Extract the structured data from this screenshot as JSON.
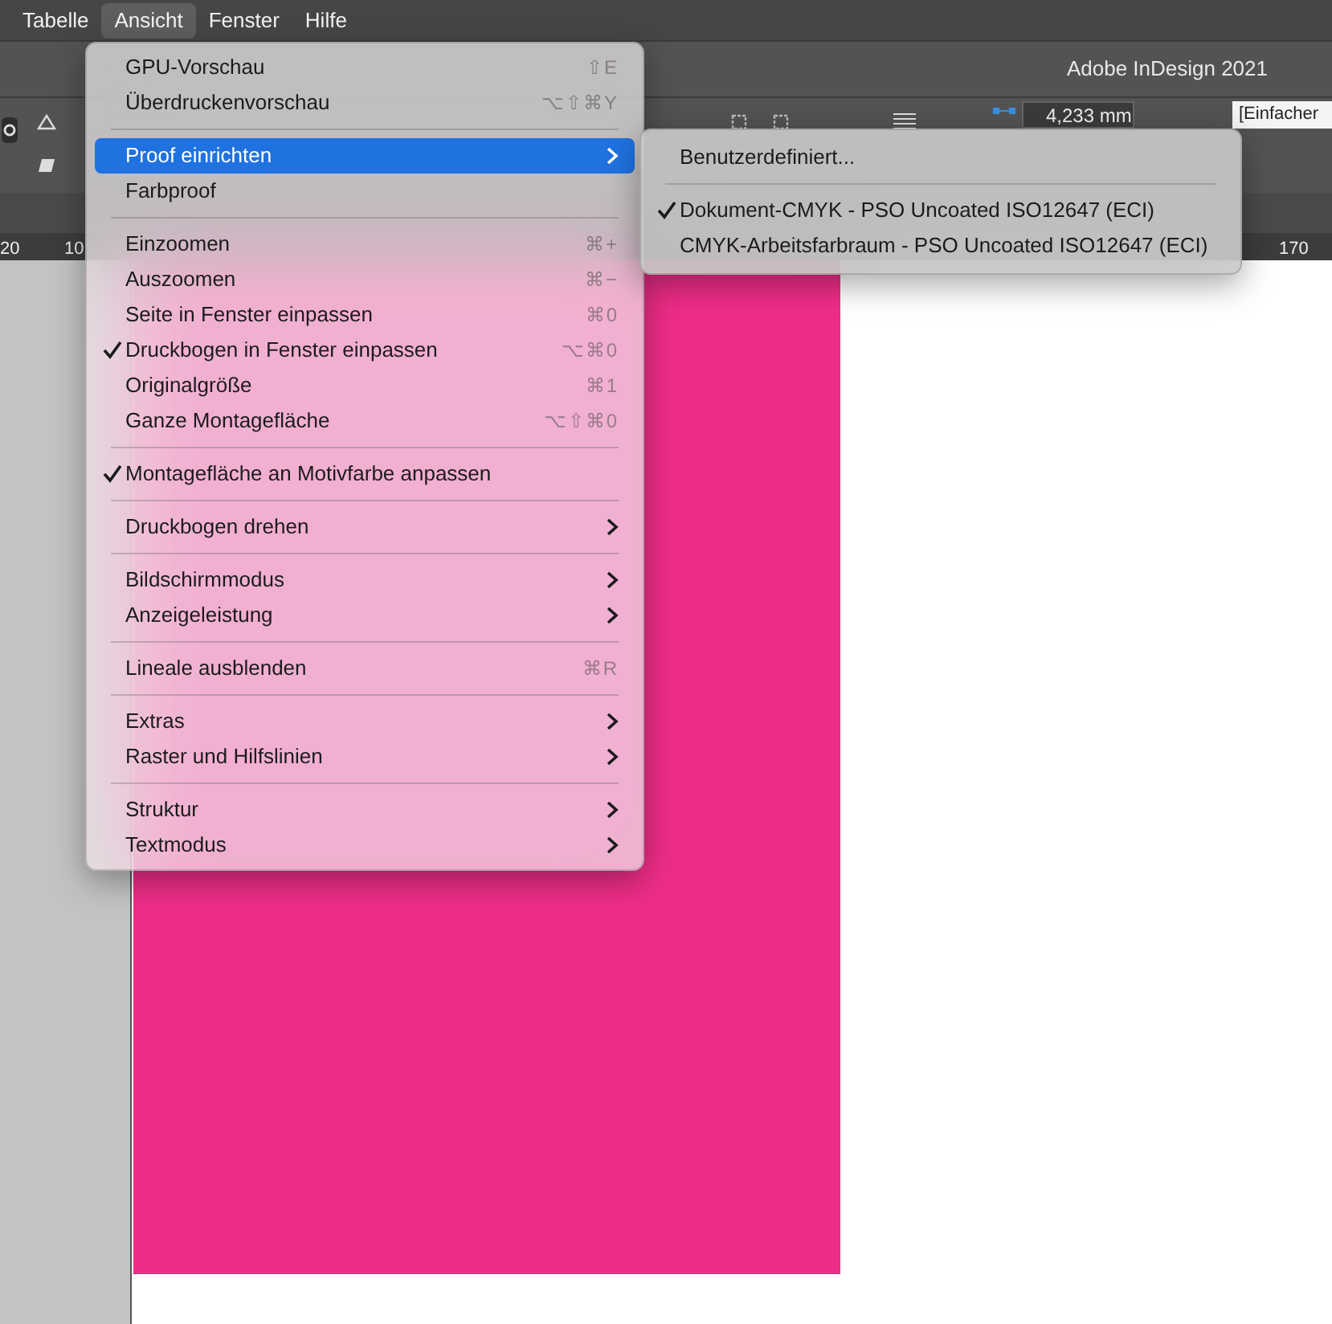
{
  "menubar": [
    {
      "label": "Tabelle",
      "selected": false
    },
    {
      "label": "Ansicht",
      "selected": true
    },
    {
      "label": "Fenster",
      "selected": false
    },
    {
      "label": "Hilfe",
      "selected": false
    }
  ],
  "window": {
    "title": "Adobe InDesign 2021"
  },
  "control_panel": {
    "stroke_weight": "4,233 mm",
    "object_style": "[Einfacher"
  },
  "ruler": {
    "labels": [
      "20",
      "10",
      "170"
    ]
  },
  "menu": [
    {
      "kind": "item",
      "label": "GPU-Vorschau",
      "shortcut": "⇧E",
      "checked": false,
      "submenu": false,
      "selected": false
    },
    {
      "kind": "item",
      "label": "Überdruckenvorschau",
      "shortcut": "⌥⇧⌘Y",
      "checked": false,
      "submenu": false,
      "selected": false
    },
    {
      "kind": "separator"
    },
    {
      "kind": "item",
      "label": "Proof einrichten",
      "checked": false,
      "submenu": true,
      "selected": true
    },
    {
      "kind": "item",
      "label": "Farbproof",
      "checked": false,
      "submenu": false,
      "selected": false
    },
    {
      "kind": "separator"
    },
    {
      "kind": "item",
      "label": "Einzoomen",
      "shortcut": "⌘+",
      "checked": false,
      "submenu": false,
      "selected": false
    },
    {
      "kind": "item",
      "label": "Auszoomen",
      "shortcut": "⌘−",
      "checked": false,
      "submenu": false,
      "selected": false
    },
    {
      "kind": "item",
      "label": "Seite in Fenster einpassen",
      "shortcut": "⌘0",
      "checked": false,
      "submenu": false,
      "selected": false
    },
    {
      "kind": "item",
      "label": "Druckbogen in Fenster einpassen",
      "shortcut": "⌥⌘0",
      "checked": true,
      "submenu": false,
      "selected": false
    },
    {
      "kind": "item",
      "label": "Originalgröße",
      "shortcut": "⌘1",
      "checked": false,
      "submenu": false,
      "selected": false
    },
    {
      "kind": "item",
      "label": "Ganze Montagefläche",
      "shortcut": "⌥⇧⌘0",
      "checked": false,
      "submenu": false,
      "selected": false
    },
    {
      "kind": "separator"
    },
    {
      "kind": "item",
      "label": "Montagefläche an Motivfarbe anpassen",
      "checked": true,
      "submenu": false,
      "selected": false
    },
    {
      "kind": "separator"
    },
    {
      "kind": "item",
      "label": "Druckbogen drehen",
      "checked": false,
      "submenu": true,
      "selected": false
    },
    {
      "kind": "separator"
    },
    {
      "kind": "item",
      "label": "Bildschirmmodus",
      "checked": false,
      "submenu": true,
      "selected": false
    },
    {
      "kind": "item",
      "label": "Anzeigeleistung",
      "checked": false,
      "submenu": true,
      "selected": false
    },
    {
      "kind": "separator"
    },
    {
      "kind": "item",
      "label": "Lineale ausblenden",
      "shortcut": "⌘R",
      "checked": false,
      "submenu": false,
      "selected": false
    },
    {
      "kind": "separator"
    },
    {
      "kind": "item",
      "label": "Extras",
      "checked": false,
      "submenu": true,
      "selected": false
    },
    {
      "kind": "item",
      "label": "Raster und Hilfslinien",
      "checked": false,
      "submenu": true,
      "selected": false
    },
    {
      "kind": "separator"
    },
    {
      "kind": "item",
      "label": "Struktur",
      "checked": false,
      "submenu": true,
      "selected": false
    },
    {
      "kind": "item",
      "label": "Textmodus",
      "checked": false,
      "submenu": true,
      "selected": false
    }
  ],
  "submenu": [
    {
      "kind": "item",
      "label": "Benutzerdefiniert...",
      "checked": false,
      "selected": false
    },
    {
      "kind": "separator"
    },
    {
      "kind": "item",
      "label": "Dokument-CMYK - PSO Uncoated ISO12647 (ECI)",
      "checked": true,
      "selected": false
    },
    {
      "kind": "item",
      "label": "CMYK-Arbeitsfarbraum - PSO Uncoated ISO12647 (ECI)",
      "checked": false,
      "selected": false
    }
  ]
}
